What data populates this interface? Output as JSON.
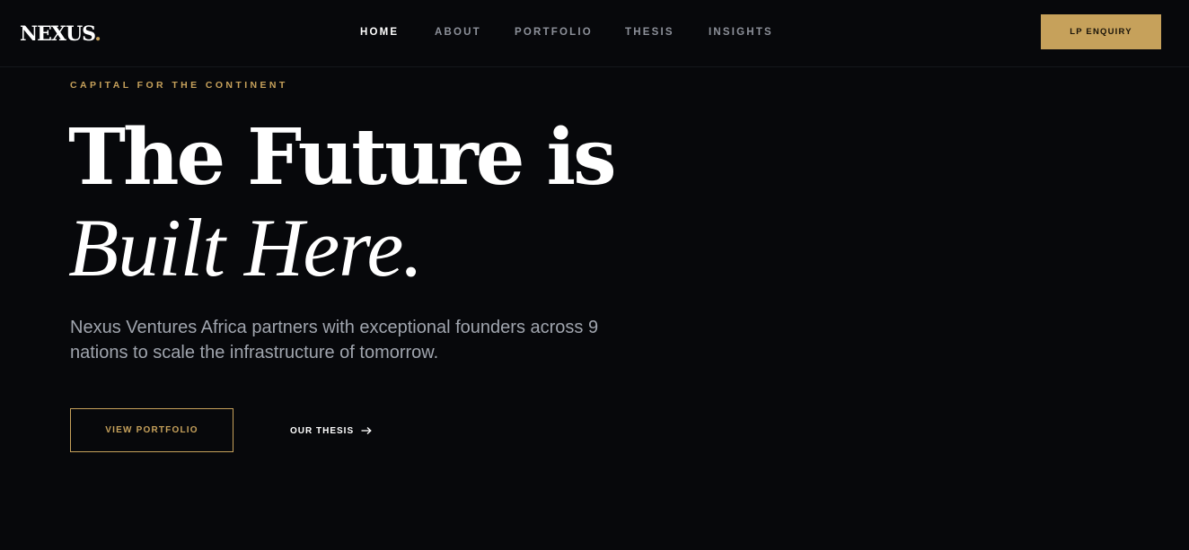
{
  "header": {
    "logo": {
      "text": "NEXUS",
      "dot": "."
    },
    "nav": [
      {
        "label": "HOME",
        "active": true
      },
      {
        "label": "ABOUT",
        "active": false
      },
      {
        "label": "PORTFOLIO",
        "active": false
      },
      {
        "label": "THESIS",
        "active": false
      },
      {
        "label": "INSIGHTS",
        "active": false
      }
    ],
    "cta_label": "LP ENQUIRY"
  },
  "hero": {
    "eyebrow": "CAPITAL FOR THE CONTINENT",
    "headline_line1": "The Future is",
    "headline_line2": "Built Here.",
    "lede": "Nexus Ventures Africa partners with exceptional founders across 9 nations to scale the infrastructure of tomorrow.",
    "primary_button": "VIEW PORTFOLIO",
    "secondary_link": "OUR THESIS",
    "secondary_icon": "arrow-right-icon"
  },
  "colors": {
    "background": "#07080b",
    "accent_gold": "#c6a15b",
    "text_primary": "#ffffff",
    "text_muted": "#a0a5ae",
    "nav_inactive": "#8d919a"
  }
}
